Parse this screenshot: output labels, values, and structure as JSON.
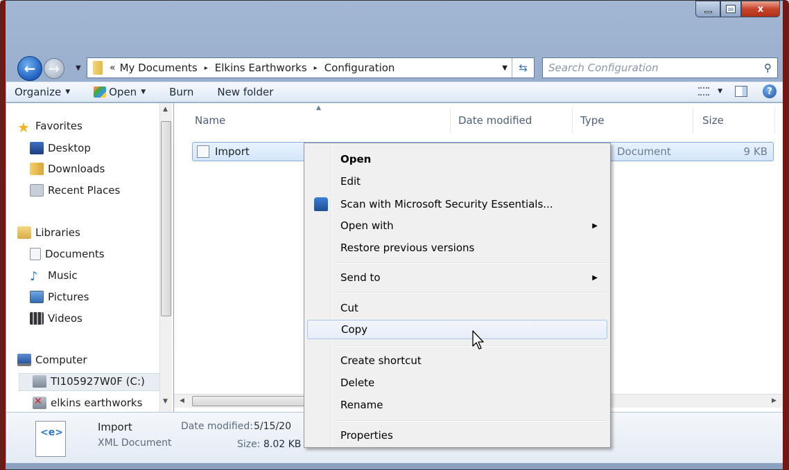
{
  "window": {
    "caption_buttons": {
      "minimize": "",
      "maximize": "",
      "close": "x"
    }
  },
  "address": {
    "overflow": "«",
    "crumbs": [
      "My Documents",
      "Elkins Earthworks",
      "Configuration"
    ],
    "separator": "▸",
    "search_placeholder": "Search Configuration"
  },
  "toolbar": {
    "organize": "Organize",
    "open": "Open",
    "burn": "Burn",
    "new_folder": "New folder"
  },
  "nav": {
    "favorites": "Favorites",
    "desktop": "Desktop",
    "downloads": "Downloads",
    "recent_places": "Recent Places",
    "libraries": "Libraries",
    "documents": "Documents",
    "music": "Music",
    "pictures": "Pictures",
    "videos": "Videos",
    "computer": "Computer",
    "drive_c": "TI105927W0F (C:)",
    "network_drive": "elkins earthworks"
  },
  "columns": {
    "name": "Name",
    "date_modified": "Date modified",
    "type": "Type",
    "size": "Size"
  },
  "file": {
    "name": "Import",
    "type": "Document",
    "size": "9 KB"
  },
  "details": {
    "name": "Import",
    "type": "XML Document",
    "date_label": "Date modified:",
    "date_value": "5/15/20",
    "size_label": "Size:",
    "size_value": "8.02 KB"
  },
  "context_menu": {
    "open": "Open",
    "edit": "Edit",
    "scan": "Scan with Microsoft Security Essentials...",
    "open_with": "Open with",
    "restore": "Restore previous versions",
    "send_to": "Send to",
    "cut": "Cut",
    "copy": "Copy",
    "create_shortcut": "Create shortcut",
    "delete": "Delete",
    "rename": "Rename",
    "properties": "Properties"
  },
  "colors": {
    "frame_accent": "#7a1510",
    "selection": "#d4e6fb",
    "menu_background": "#f0f0f0"
  }
}
